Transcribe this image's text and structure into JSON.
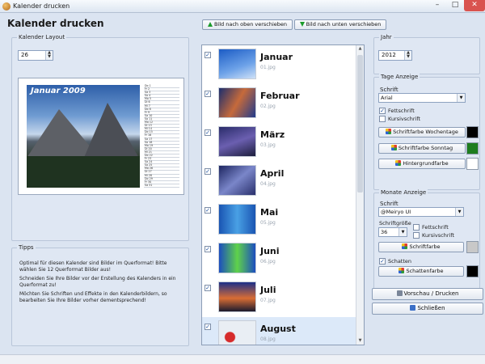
{
  "window": {
    "title": "Kalender drucken"
  },
  "heading": "Kalender drucken",
  "layout_group": {
    "label": "Kalender Layout",
    "spin_value": "26"
  },
  "preview": {
    "photo_title": "Januar 2009",
    "day_rows": [
      "Do 1",
      "Fr 2",
      "Sa 3",
      "So 4",
      "Mo 5",
      "Di 6",
      "Mi 7",
      "Do 8",
      "Fr 9",
      "Sa 10",
      "So 11",
      "Mo 12",
      "Di 13",
      "Mi 14",
      "Do 15",
      "Fr 16",
      "Sa 17",
      "So 18",
      "Mo 19",
      "Di 20",
      "Mi 21",
      "Do 22",
      "Fr 23",
      "Sa 24",
      "So 25",
      "Mo 26",
      "Di 27",
      "Mi 28",
      "Do 29",
      "Fr 30",
      "Sa 31"
    ]
  },
  "tips": {
    "label": "Tipps",
    "items": [
      "Optimal für diesen Kalender sind Bilder im Querformat! Bitte wählen Sie 12 Querformat Bilder aus!",
      "Schneiden Sie Ihre Bilder vor der Erstellung des Kalenders in ein Querformat zu!",
      "Möchten Sie Schriften und Effekte in den Kalenderbildern, so bearbeiten Sie Ihre Bilder vorher dementsprechend!"
    ]
  },
  "toolbar": {
    "move_up": "Bild nach oben verschieben",
    "move_down": "Bild nach unten verschieben"
  },
  "months": [
    {
      "name": "Januar",
      "file": "01.jpg",
      "checked": true
    },
    {
      "name": "Februar",
      "file": "02.jpg",
      "checked": true
    },
    {
      "name": "März",
      "file": "03.jpg",
      "checked": true
    },
    {
      "name": "April",
      "file": "04.jpg",
      "checked": true
    },
    {
      "name": "Mai",
      "file": "05.jpg",
      "checked": true
    },
    {
      "name": "Juni",
      "file": "06.jpg",
      "checked": true
    },
    {
      "name": "Juli",
      "file": "07.jpg",
      "checked": true
    },
    {
      "name": "August",
      "file": "08.jpg",
      "checked": true
    }
  ],
  "year_group": {
    "label": "Jahr",
    "value": "2012"
  },
  "days_group": {
    "label": "Tage Anzeige",
    "font_label": "Schrift",
    "font_value": "Arial",
    "bold_label": "Fettschrift",
    "bold_checked": true,
    "italic_label": "Kursivschrift",
    "italic_checked": false,
    "weekday_color_btn": "Schriftfarbe Wochentage",
    "weekday_color": "#000000",
    "sunday_color_btn": "Schriftfarbe Sonntag",
    "sunday_color": "#1e7d1e",
    "bg_color_btn": "Hintergrundfarbe",
    "bg_color": "#ffffff"
  },
  "months_group": {
    "label": "Monate Anzeige",
    "font_label": "Schrift",
    "font_value": "@Meiryo UI",
    "size_label": "Schriftgröße",
    "size_value": "36",
    "bold_label": "Fettschrift",
    "bold_checked": false,
    "italic_label": "Kursivschrift",
    "italic_checked": false,
    "font_color_btn": "Schriftfarbe",
    "font_color": "#c8c8c8",
    "shadow_label": "Schatten",
    "shadow_checked": true,
    "shadow_color_btn": "Schattenfarbe",
    "shadow_color": "#000000"
  },
  "actions": {
    "preview_print": "Vorschau / Drucken",
    "close": "Schließen"
  }
}
